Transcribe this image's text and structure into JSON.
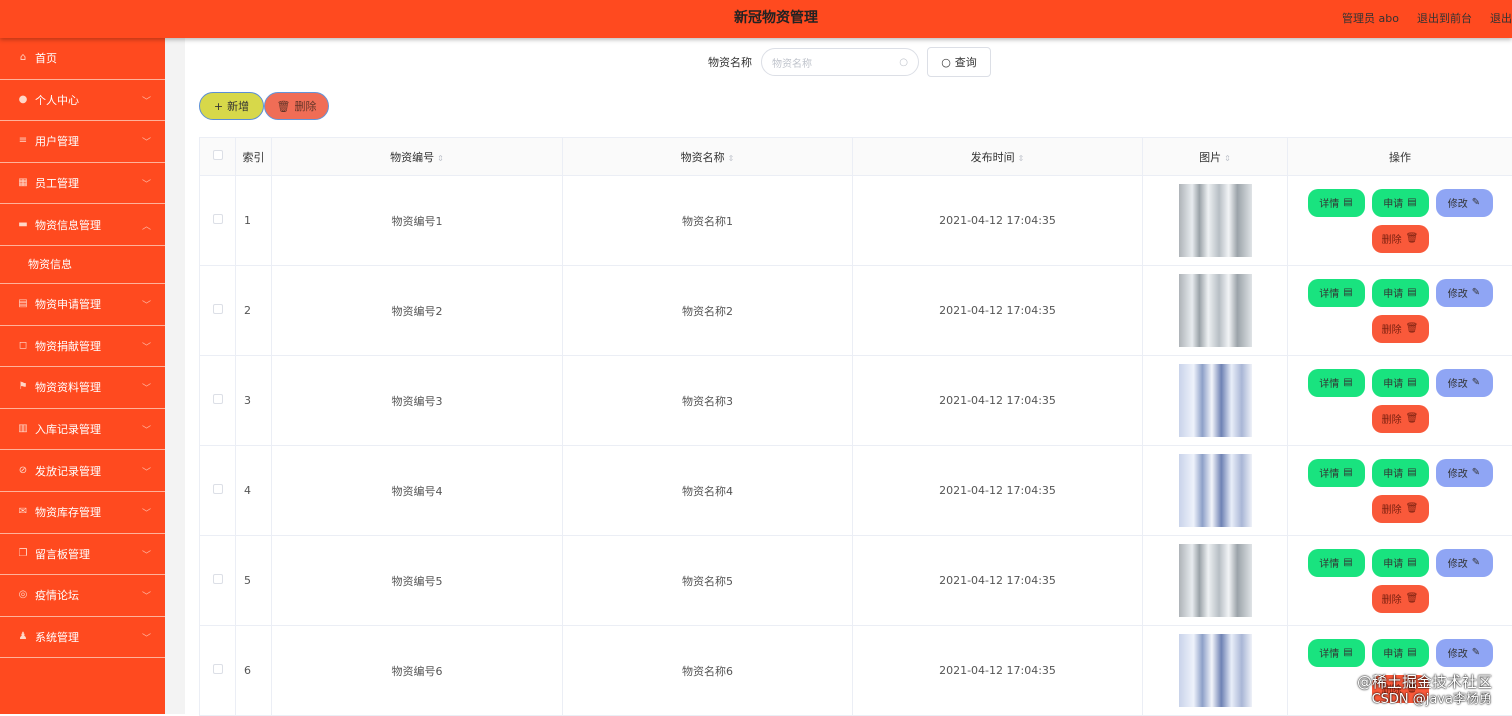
{
  "header": {
    "title": "新冠物资管理",
    "admin": "管理员 abo",
    "exit_front": "退出到前台",
    "logout": "退出登录"
  },
  "sidebar": {
    "items": [
      {
        "label": "首页",
        "icon": "home-icon"
      },
      {
        "label": "个人中心",
        "icon": "user-icon"
      },
      {
        "label": "用户管理",
        "icon": "sliders-icon"
      },
      {
        "label": "员工管理",
        "icon": "grid-icon"
      },
      {
        "label": "物资信息管理",
        "icon": "chat-icon",
        "expanded": true,
        "children": [
          "物资信息"
        ]
      },
      {
        "label": "物资申请管理",
        "icon": "doc-icon"
      },
      {
        "label": "物资捐献管理",
        "icon": "crop-icon"
      },
      {
        "label": "物资资料管理",
        "icon": "flag-icon"
      },
      {
        "label": "入库记录管理",
        "icon": "chart-icon"
      },
      {
        "label": "发放记录管理",
        "icon": "block-icon"
      },
      {
        "label": "物资库存管理",
        "icon": "mail-icon"
      },
      {
        "label": "留言板管理",
        "icon": "copy-icon"
      },
      {
        "label": "疫情论坛",
        "icon": "compass-icon"
      },
      {
        "label": "系统管理",
        "icon": "admin-icon"
      }
    ]
  },
  "search": {
    "label": "物资名称",
    "placeholder": "物资名称",
    "button": "查询"
  },
  "toolbar": {
    "add": "新增",
    "delete": "删除"
  },
  "table": {
    "headers": [
      "索引",
      "物资编号",
      "物资名称",
      "发布时间",
      "图片",
      "操作"
    ],
    "rows": [
      {
        "index": "1",
        "code": "物资编号1",
        "name": "物资名称1",
        "time": "2021-04-12 17:04:35",
        "img": "gray"
      },
      {
        "index": "2",
        "code": "物资编号2",
        "name": "物资名称2",
        "time": "2021-04-12 17:04:35",
        "img": "gray"
      },
      {
        "index": "3",
        "code": "物资编号3",
        "name": "物资名称3",
        "time": "2021-04-12 17:04:35",
        "img": "blue"
      },
      {
        "index": "4",
        "code": "物资编号4",
        "name": "物资名称4",
        "time": "2021-04-12 17:04:35",
        "img": "blue"
      },
      {
        "index": "5",
        "code": "物资编号5",
        "name": "物资名称5",
        "time": "2021-04-12 17:04:35",
        "img": "gray"
      },
      {
        "index": "6",
        "code": "物资编号6",
        "name": "物资名称6",
        "time": "2021-04-12 17:04:35",
        "img": "blue"
      }
    ],
    "ops": {
      "detail": "详情",
      "apply": "申请",
      "edit": "修改",
      "delete": "删除"
    }
  },
  "watermark": {
    "line1": "@稀土掘金技术社区",
    "line2": "CSDN @java李杨勇"
  },
  "colors": {
    "primary": "#ff4a1f",
    "green": "#19e37f",
    "blue": "#8fa5f4",
    "red": "#f9593a",
    "yellow": "#d7d84a"
  }
}
